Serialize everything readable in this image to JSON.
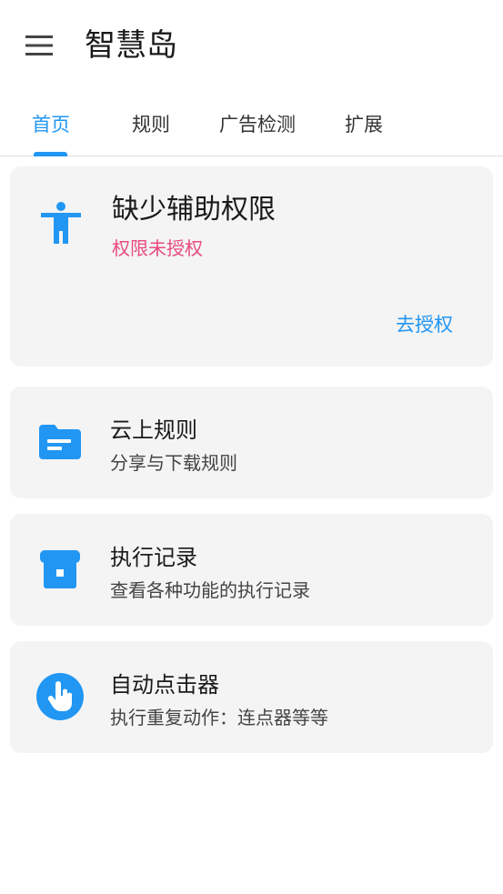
{
  "app": {
    "title": "智慧岛"
  },
  "colors": {
    "accent": "#2196f3",
    "warning": "#e84a7f",
    "card_bg": "#f4f4f4"
  },
  "tabs": [
    {
      "label": "首页",
      "active": true
    },
    {
      "label": "规则",
      "active": false
    },
    {
      "label": "广告检测",
      "active": false
    },
    {
      "label": "扩展",
      "active": false
    }
  ],
  "auth_card": {
    "icon": "accessibility-icon",
    "title": "缺少辅助权限",
    "status": "权限未授权",
    "action_label": "去授权"
  },
  "features": [
    {
      "icon": "folder-icon",
      "title": "云上规则",
      "subtitle": "分享与下载规则"
    },
    {
      "icon": "archive-icon",
      "title": "执行记录",
      "subtitle": "查看各种功能的执行记录"
    },
    {
      "icon": "touch-icon",
      "title": "自动点击器",
      "subtitle": "执行重复动作：连点器等等"
    }
  ]
}
